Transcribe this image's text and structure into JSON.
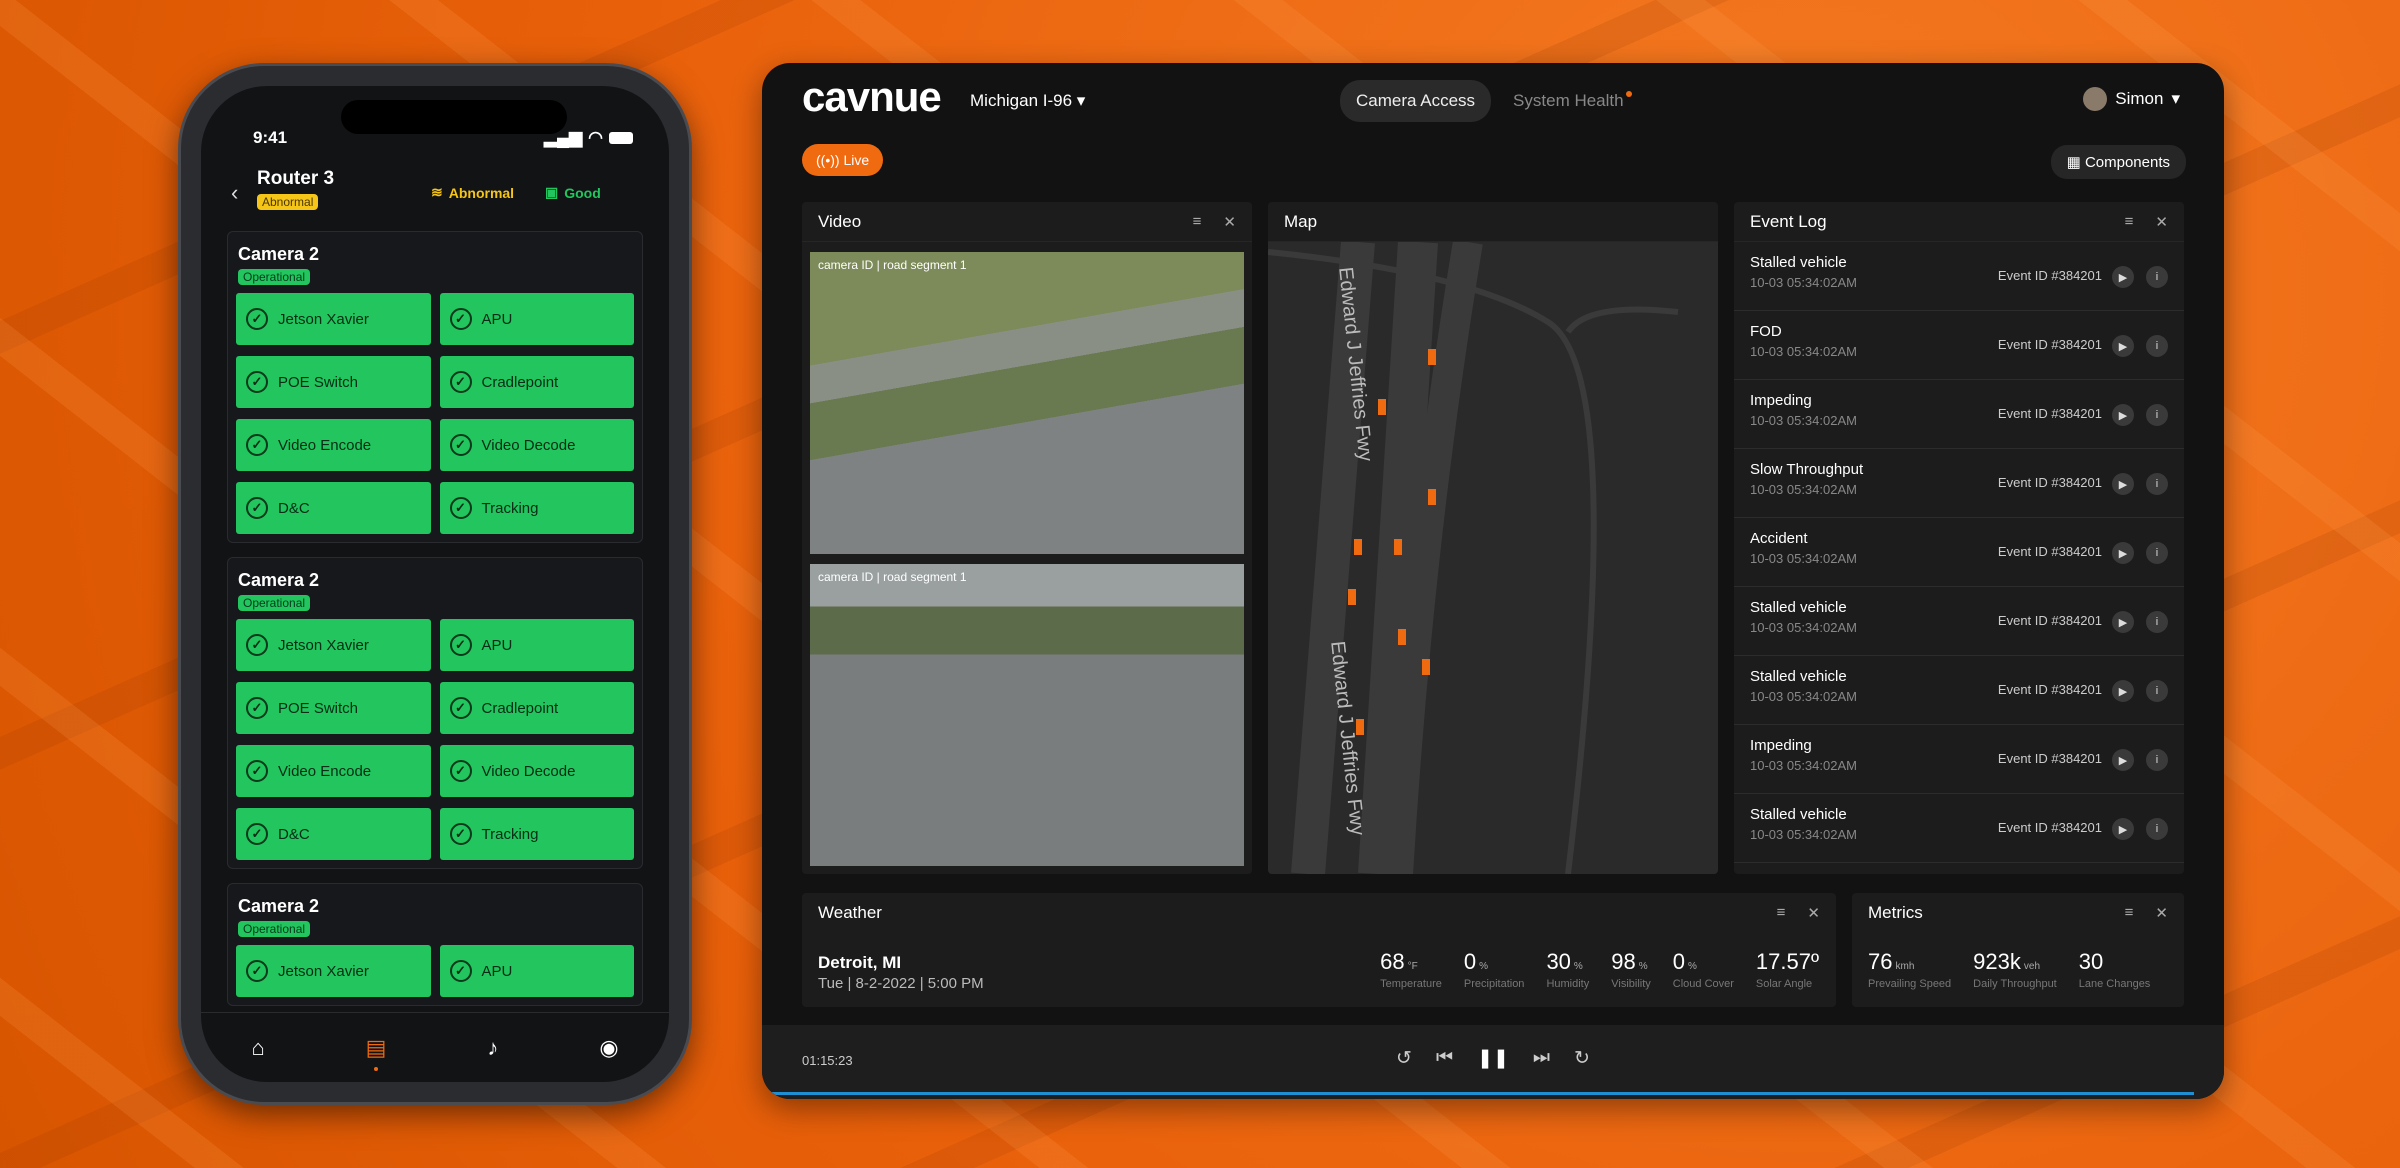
{
  "phone": {
    "time": "9:41",
    "title": "Router 3",
    "status_badge": "Abnormal",
    "wifi_status": "Abnormal",
    "chip_status": "Good",
    "cards": [
      {
        "title": "Camera 2",
        "status": "Operational",
        "items": [
          "Jetson Xavier",
          "APU",
          "POE Switch",
          "Cradlepoint",
          "Video Encode",
          "Video Decode",
          "D&C",
          "Tracking"
        ]
      },
      {
        "title": "Camera 2",
        "status": "Operational",
        "items": [
          "Jetson Xavier",
          "APU",
          "POE Switch",
          "Cradlepoint",
          "Video Encode",
          "Video Decode",
          "D&C",
          "Tracking"
        ]
      },
      {
        "title": "Camera 2",
        "status": "Operational",
        "items": [
          "Jetson Xavier",
          "APU"
        ]
      }
    ]
  },
  "dash": {
    "logo": "cavnue",
    "region": "Michigan I-96",
    "tabs": [
      "Camera Access",
      "System Health"
    ],
    "user": "Simon",
    "live": "Live",
    "components": "Components",
    "video": {
      "title": "Video",
      "captions": [
        "camera ID  |  road segment 1",
        "camera ID  |  road segment 1"
      ]
    },
    "map": {
      "title": "Map",
      "street": "Edward J Jeffries Fwy"
    },
    "event_log": {
      "title": "Event Log",
      "events": [
        {
          "type": "Stalled vehicle",
          "time": "10-03 05:34:02AM",
          "id": "Event ID #384201"
        },
        {
          "type": "FOD",
          "time": "10-03 05:34:02AM",
          "id": "Event ID #384201"
        },
        {
          "type": "Impeding",
          "time": "10-03 05:34:02AM",
          "id": "Event ID #384201"
        },
        {
          "type": "Slow Throughput",
          "time": "10-03 05:34:02AM",
          "id": "Event ID #384201"
        },
        {
          "type": "Accident",
          "time": "10-03 05:34:02AM",
          "id": "Event ID #384201"
        },
        {
          "type": "Stalled vehicle",
          "time": "10-03 05:34:02AM",
          "id": "Event ID #384201"
        },
        {
          "type": "Stalled vehicle",
          "time": "10-03 05:34:02AM",
          "id": "Event ID #384201"
        },
        {
          "type": "Impeding",
          "time": "10-03 05:34:02AM",
          "id": "Event ID #384201"
        },
        {
          "type": "Stalled vehicle",
          "time": "10-03 05:34:02AM",
          "id": "Event ID #384201"
        }
      ]
    },
    "weather": {
      "title": "Weather",
      "location": "Detroit, MI",
      "date": "Tue | 8-2-2022 |  5:00 PM",
      "metrics": [
        {
          "value": "68",
          "unit": "°F",
          "label": "Temperature"
        },
        {
          "value": "0",
          "unit": "%",
          "label": "Precipitation"
        },
        {
          "value": "30",
          "unit": "%",
          "label": "Humidity"
        },
        {
          "value": "98",
          "unit": "%",
          "label": "Visibility"
        },
        {
          "value": "0",
          "unit": "%",
          "label": "Cloud Cover"
        },
        {
          "value": "17.57º",
          "unit": "",
          "label": "Solar Angle"
        }
      ]
    },
    "metrics": {
      "title": "Metrics",
      "items": [
        {
          "value": "76",
          "unit": "kmh",
          "label": "Prevailing Speed"
        },
        {
          "value": "923k",
          "unit": "veh",
          "label": "Daily Throughput"
        },
        {
          "value": "30",
          "unit": "",
          "label": "Lane Changes"
        }
      ]
    },
    "player": {
      "time": "01:15:23",
      "progress": 1.0
    }
  },
  "colors": {
    "accent": "#f06a10",
    "ok": "#22c55e",
    "warn": "#f5c518"
  }
}
